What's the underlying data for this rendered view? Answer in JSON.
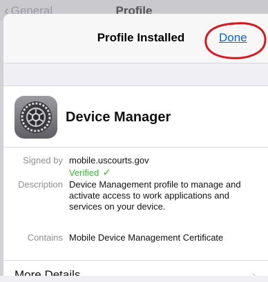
{
  "background_nav": {
    "back_label": "General",
    "title": "Profile"
  },
  "sheet": {
    "title": "Profile Installed",
    "done_label": "Done"
  },
  "profile": {
    "name": "Device Manager",
    "icon": "gear-icon"
  },
  "details": {
    "signed_by_label": "Signed by",
    "signed_by_value": "mobile.uscourts.gov",
    "verified_label": "Verified",
    "verified_icon": "checkmark-icon",
    "description_label": "Description",
    "description_value": "Device Management profile to manage and activate access to work applications and services on your device.",
    "contains_label": "Contains",
    "contains_value": "Mobile Device Management Certificate"
  },
  "more_details": {
    "label": "More Details",
    "icon": "chevron-right-icon"
  },
  "colors": {
    "link_blue": "#0a63d8",
    "verified_green": "#3eb43a",
    "annotation_red": "#d9161b"
  }
}
